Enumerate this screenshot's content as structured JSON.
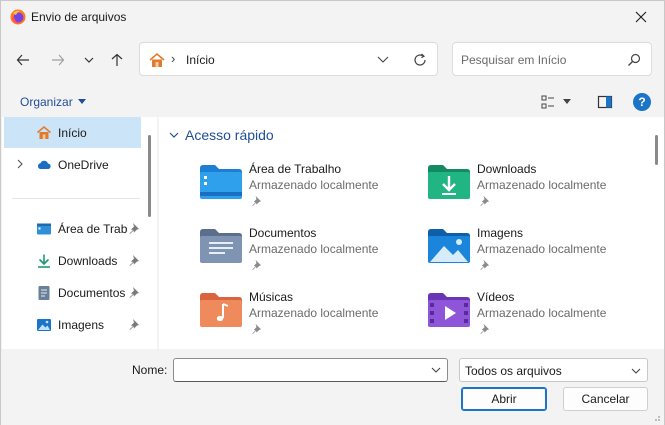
{
  "window": {
    "title": "Envio de arquivos",
    "app_icon": "firefox-icon"
  },
  "nav": {
    "address_location": "Início",
    "search_placeholder": "Pesquisar em Início"
  },
  "command_bar": {
    "organize_label": "Organizar"
  },
  "sidebar": {
    "items": [
      {
        "label": "Início",
        "icon": "home-icon",
        "selected": true,
        "pinned": false,
        "expandable": false
      },
      {
        "label": "OneDrive",
        "icon": "cloud-icon",
        "selected": false,
        "pinned": false,
        "expandable": true
      },
      {
        "label": "Área de Trabalho",
        "icon": "desktop-icon",
        "selected": false,
        "pinned": true,
        "expandable": false
      },
      {
        "label": "Downloads",
        "icon": "download-icon",
        "selected": false,
        "pinned": true,
        "expandable": false
      },
      {
        "label": "Documentos",
        "icon": "document-icon",
        "selected": false,
        "pinned": true,
        "expandable": false
      },
      {
        "label": "Imagens",
        "icon": "image-icon",
        "selected": false,
        "pinned": true,
        "expandable": false
      }
    ]
  },
  "main": {
    "section_title": "Acesso rápido",
    "tiles": [
      {
        "name": "Área de Trabalho",
        "subtitle": "Armazenado localmente",
        "icon": "desktop-folder-icon"
      },
      {
        "name": "Downloads",
        "subtitle": "Armazenado localmente",
        "icon": "downloads-folder-icon"
      },
      {
        "name": "Documentos",
        "subtitle": "Armazenado localmente",
        "icon": "documents-folder-icon"
      },
      {
        "name": "Imagens",
        "subtitle": "Armazenado localmente",
        "icon": "pictures-folder-icon"
      },
      {
        "name": "Músicas",
        "subtitle": "Armazenado localmente",
        "icon": "music-folder-icon"
      },
      {
        "name": "Vídeos",
        "subtitle": "Armazenado localmente",
        "icon": "videos-folder-icon"
      }
    ]
  },
  "footer": {
    "name_label": "Nome:",
    "name_value": "",
    "file_type": "Todos os arquivos",
    "open_label": "Abrir",
    "cancel_label": "Cancelar"
  },
  "colors": {
    "accent": "#1b74c7",
    "selection": "#cce4f7",
    "link": "#1f4e99"
  }
}
